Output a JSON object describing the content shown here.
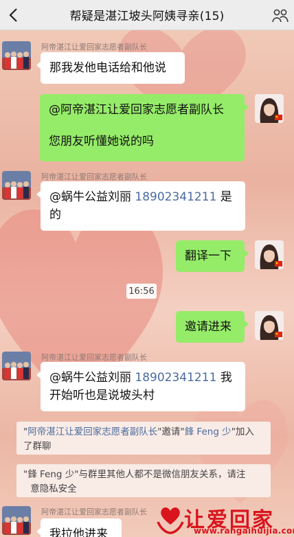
{
  "header": {
    "title": "帮疑是湛江坡头阿姨寻亲(15)",
    "back_icon": "back-chevron-icon",
    "more_icon": "more-options-icon"
  },
  "messages": [
    {
      "side": "left",
      "sender": "阿帝湛江让爱回家志愿者副队长",
      "text": "那我发他电话给和他说"
    },
    {
      "side": "right",
      "line1": "@阿帝湛江让爱回家志愿者副队长",
      "line2": "您朋友听懂她说的吗"
    },
    {
      "side": "left",
      "sender": "阿帝湛江让爱回家志愿者副队长",
      "prefix": "@蜗牛公益刘丽 ",
      "phone": "18902341211",
      "suffix": " 是",
      "line2": "的"
    },
    {
      "side": "right",
      "text": "翻译一下"
    },
    {
      "side": "right",
      "text": "邀请进来"
    },
    {
      "side": "left",
      "sender": "阿帝湛江让爱回家志愿者副队长",
      "prefix": "@蜗牛公益刘丽 ",
      "phone": "18902341211",
      "suffix": " 我",
      "line2": "开始听也是说坡头村"
    },
    {
      "side": "left",
      "sender": "阿帝湛江让爱回家志愿者副队长",
      "text": "我拉他进来"
    }
  ],
  "timestamp": "16:56",
  "system": {
    "invite": {
      "q1": "\"",
      "inviter": "阿帝湛江让爱回家志愿者副队长",
      "mid": "\"邀请\"",
      "invitee": "鋒 Feng 少",
      "end": "\"加入",
      "line2": "了群聊"
    },
    "notice": {
      "line1": "\"鋒 Feng 少\"与群里其他人都不是微信朋友关系，请注",
      "line2": "意隐私安全"
    }
  },
  "watermark": {
    "text": "让爱回家",
    "url": "www.rangaihuijia.com"
  },
  "colors": {
    "green_bubble": "#95ec69",
    "link_blue": "#4a6a9e",
    "watermark_red": "#d9141d",
    "titlebar": "#ededed"
  }
}
